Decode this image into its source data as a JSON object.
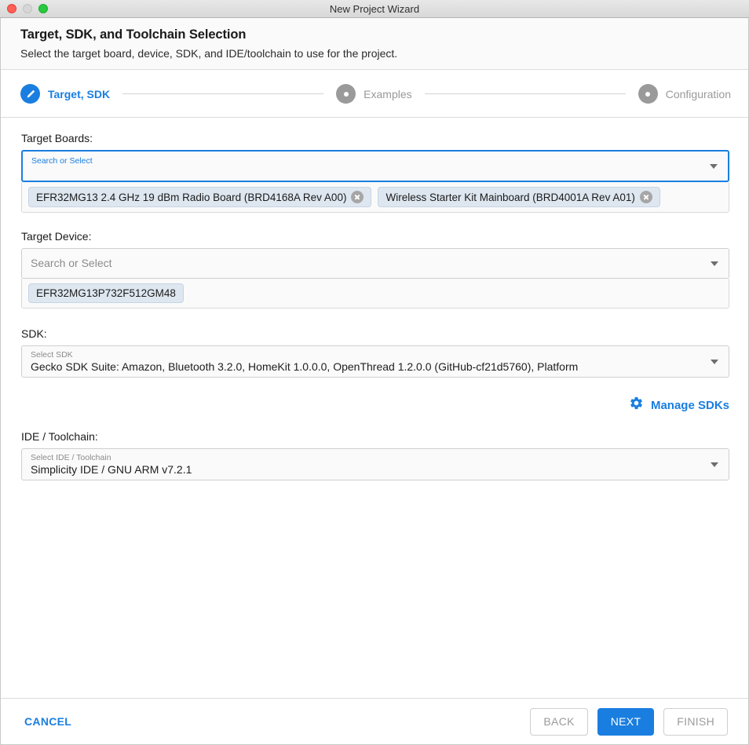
{
  "window": {
    "title": "New Project Wizard",
    "traffic_lights": [
      "close-button",
      "minimize-button",
      "maximize-button"
    ]
  },
  "header": {
    "title": "Target, SDK, and Toolchain Selection",
    "subtitle": "Select the target board, device, SDK, and IDE/toolchain to use for the project."
  },
  "stepper": {
    "steps": [
      {
        "label": "Target, SDK",
        "state": "active",
        "icon": "pencil-icon"
      },
      {
        "label": "Examples",
        "state": "inactive",
        "icon": "dot-icon"
      },
      {
        "label": "Configuration",
        "state": "inactive",
        "icon": "dot-icon"
      }
    ]
  },
  "target_boards": {
    "label": "Target Boards:",
    "placeholder": "Search or Select",
    "focused": true,
    "chips": [
      {
        "label": "EFR32MG13 2.4 GHz 19 dBm Radio Board (BRD4168A Rev A00)",
        "removable": true
      },
      {
        "label": "Wireless Starter Kit Mainboard (BRD4001A Rev A01)",
        "removable": true
      }
    ]
  },
  "target_device": {
    "label": "Target Device:",
    "placeholder": "Search or Select",
    "chips": [
      {
        "label": "EFR32MG13P732F512GM48",
        "removable": false
      }
    ]
  },
  "sdk": {
    "label": "SDK:",
    "float_label": "Select SDK",
    "value": "Gecko SDK Suite: Amazon, Bluetooth 3.2.0, HomeKit 1.0.0.0, OpenThread 1.2.0.0 (GitHub-cf21d5760), Platform"
  },
  "manage_sdks": {
    "label": "Manage SDKs",
    "icon": "gear-icon"
  },
  "ide_toolchain": {
    "label": "IDE / Toolchain:",
    "float_label": "Select IDE / Toolchain",
    "value": "Simplicity IDE / GNU ARM v7.2.1"
  },
  "footer": {
    "cancel": "CANCEL",
    "back": "BACK",
    "next": "NEXT",
    "finish": "FINISH"
  },
  "colors": {
    "accent": "#1a7ee0",
    "chip_bg": "#dee7f0",
    "inactive": "#9a9a9a"
  }
}
